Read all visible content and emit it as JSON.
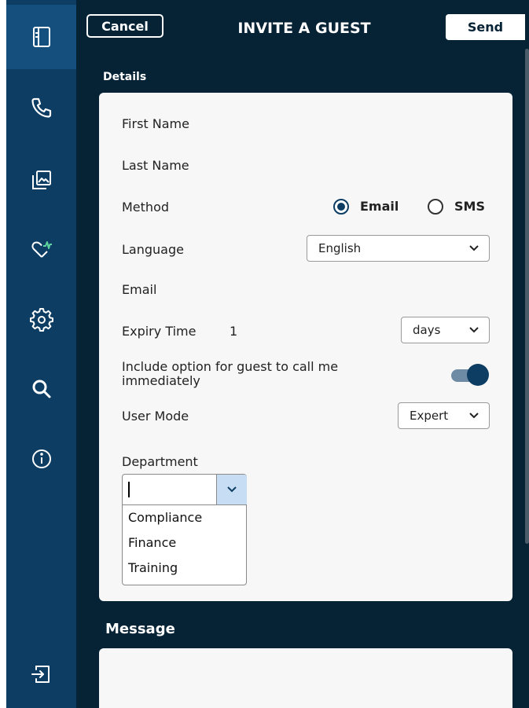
{
  "header": {
    "cancel_label": "Cancel",
    "title": "INVITE A GUEST",
    "send_label": "Send"
  },
  "sidebar": {
    "items": [
      {
        "icon": "sidebar-panel-icon",
        "active": true
      },
      {
        "icon": "phone-icon"
      },
      {
        "icon": "gallery-icon"
      },
      {
        "icon": "health-heart-icon"
      },
      {
        "icon": "gear-icon"
      },
      {
        "icon": "search-icon"
      },
      {
        "icon": "info-icon"
      },
      {
        "icon": "logout-icon"
      }
    ]
  },
  "details": {
    "section_label": "Details",
    "first_name_label": "First Name",
    "last_name_label": "Last Name",
    "method_label": "Method",
    "method_options": [
      "Email",
      "SMS"
    ],
    "method_selected": "Email",
    "language_label": "Language",
    "language_value": "English",
    "email_label": "Email",
    "expiry_label": "Expiry Time",
    "expiry_value": "1",
    "expiry_unit": "days",
    "call_option_label_line1": "Include option for guest to call me",
    "call_option_label_line2": "immediately",
    "call_option_enabled": true,
    "user_mode_label": "User Mode",
    "user_mode_value": "Expert",
    "department_label": "Department",
    "department_options": [
      "Compliance",
      "Finance",
      "Training"
    ]
  },
  "message": {
    "label": "Message"
  },
  "colors": {
    "sidebar_bg": "#0d3d63",
    "main_bg": "#062235",
    "accent": "#0d3d63",
    "card_bg": "#f7f7f7"
  }
}
